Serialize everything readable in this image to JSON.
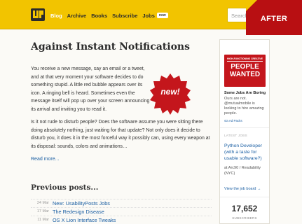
{
  "nav": {
    "items": [
      {
        "label": "Blog",
        "active": true
      },
      {
        "label": "Archive"
      },
      {
        "label": "Books"
      },
      {
        "label": "Subscribe"
      },
      {
        "label": "Jobs"
      }
    ],
    "jobs_badge": "new",
    "search_placeholder": "Search",
    "corner_label": "AFTER"
  },
  "article": {
    "title": "Against Instant Notifications",
    "paragraph1": "You receive a new message, say an email or a tweet, and at that very moment your software decides to do something stupid. A little red bubble appears over its icon. A ringing bell is heard. Sometimes even the message itself will pop up over your screen announcing its arrival and inviting you to read it.",
    "paragraph2": "Is it not rude to disturb people? Does the software assume you were sitting there doing absolutely nothing, just waiting for that update? Not only does it decide to disturb you, it does it in the most forceful way it possibly can, using every weapon at its disposal: sounds, colors and animations…",
    "read_more": "Read more...",
    "badge": "new!"
  },
  "previous": {
    "heading": "Previous posts...",
    "posts": [
      {
        "date": "24 Mar",
        "title": "New: UsabilityPosts Jobs"
      },
      {
        "date": "17 Mar",
        "title": "The Redesign Disease"
      },
      {
        "date": "11 Mar",
        "title": "OS X Lion Interface Tweaks"
      }
    ]
  },
  "sidebar": {
    "ad_tag": "HIGH-FUNCTIONING CREATIVE",
    "ad_line1": "PEOPLE",
    "ad_line2": "WANTED",
    "ad_head": "Some Jobs Are Boring",
    "ad_text": "Ours are not. @mutualmobile is looking to hire amazing people.",
    "ad_via": "via Ad Packs",
    "latest_label": "LATEST JOBS",
    "job_title": "Python Developer (with a taste for usable software?)",
    "job_meta": "at Arc90 / Readability (NYC)",
    "job_board": "View the job board →",
    "subscriber_count": "17,652",
    "subscriber_label": "SUBSCRIBERS"
  },
  "colors": {
    "nav_bg": "#f2c400",
    "link": "#1b5fa3",
    "badge_red": "#c4161c"
  }
}
